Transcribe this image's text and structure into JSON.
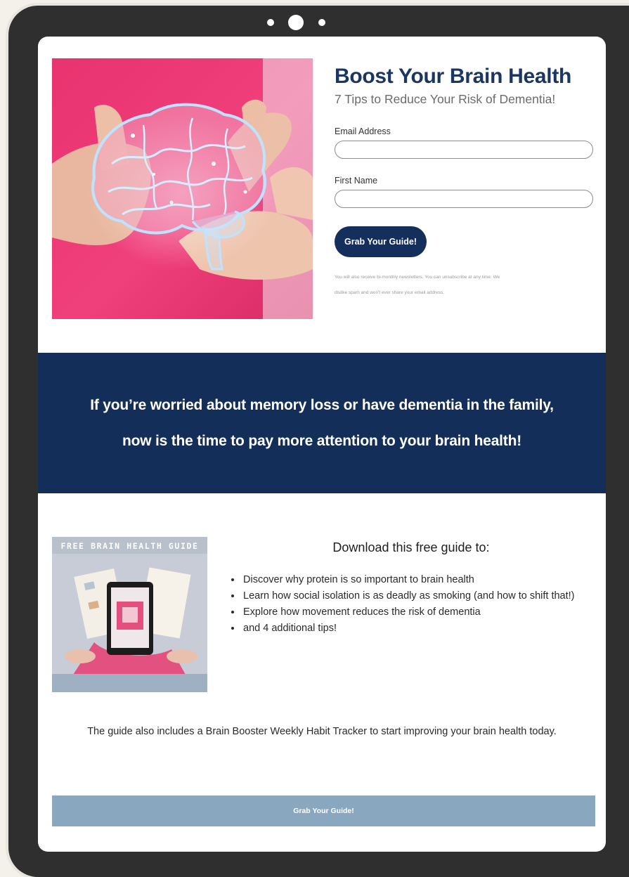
{
  "hero": {
    "image_alt": "hands-holding-glowing-brain",
    "title": "Boost Your Brain Health",
    "subtitle": "7 Tips to Reduce Your Risk of Dementia!"
  },
  "form": {
    "email_label": "Email Address",
    "email_value": "",
    "first_name_label": "First Name",
    "first_name_value": "",
    "submit_label": "Grab Your Guide!",
    "disclaimer_line1": "You will also receive bi-monthly newsletters. You can unsubscribe at any time. We",
    "disclaimer_line2": "dislike spam and won't ever share your email address."
  },
  "banner": {
    "line1": "If you’re worried about memory loss or have dementia in the family,",
    "line2": "now is the time to pay more attention to your brain health!"
  },
  "guide": {
    "cover_title": "FREE BRAIN HEALTH GUIDE",
    "heading": "Download this free guide to:",
    "bullets": [
      "Discover why protein is so important to brain health",
      "Learn how social isolation is as deadly as smoking (and how to shift that!)",
      "Explore how movement reduces the risk of dementia",
      "and 4 additional tips!"
    ],
    "footer_text": "The guide also includes a Brain Booster Weekly Habit Tracker to start improving your brain health today.",
    "cta_label": "Grab Your Guide!"
  },
  "colors": {
    "navy": "#142e5a",
    "title_navy": "#1b3660",
    "cta_bar": "#8aa7c0",
    "bezel": "#2f2f2f"
  }
}
